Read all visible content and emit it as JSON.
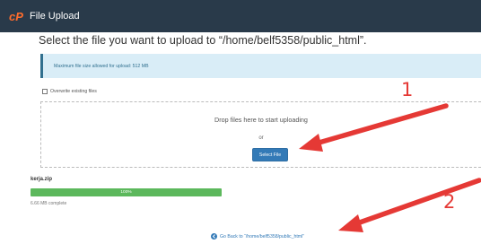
{
  "header": {
    "logo": "cP",
    "title": "File Upload"
  },
  "page": {
    "heading": "Select the file you want to upload to “/home/belf5358/public_html”."
  },
  "info": {
    "max_size_text": "Maximum file size allowed for upload: 512 MB"
  },
  "options": {
    "overwrite_label": "Overwrite existing files",
    "overwrite_checked": false
  },
  "dropzone": {
    "drop_text": "Drop files here to start uploading",
    "or_text": "or",
    "select_button": "Select File"
  },
  "upload": {
    "file_name": "kerja.zip",
    "progress_percent": 100,
    "progress_text": "100%",
    "complete_text": "6.66 MB complete"
  },
  "footer": {
    "go_back_text": "Go Back to “/home/belf5358/public_html”",
    "icon": "circle-arrow-left-icon"
  },
  "annotations": {
    "label_1": "1",
    "label_2": "2",
    "color": "#e53935"
  },
  "colors": {
    "topbar": "#293a4a",
    "cpanel_orange": "#ff6c2c",
    "info_bg": "#d9edf7",
    "primary": "#337ab7",
    "success": "#5cb85c"
  }
}
